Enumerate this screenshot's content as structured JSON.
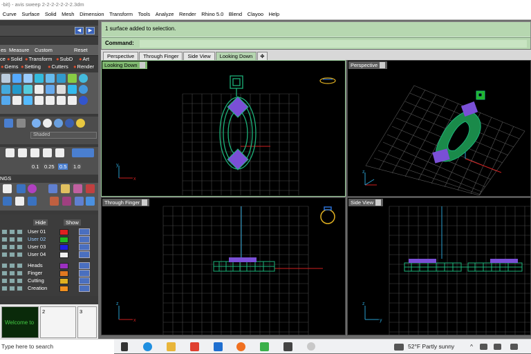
{
  "window": {
    "title": "-bit) - avis sweep 2-2-2-2-2-2-2.3dm"
  },
  "menu": {
    "items": [
      "Curve",
      "Surface",
      "Solid",
      "Mesh",
      "Dimension",
      "Transform",
      "Tools",
      "Analyze",
      "Render",
      "Rhino 5.0",
      "Blend",
      "Clayoo",
      "Help"
    ]
  },
  "command": {
    "history": "1 surface added to selection.",
    "prompt": "Command:"
  },
  "tabs": [
    "Perspective",
    "Through Finger",
    "Side View",
    "Looking Down"
  ],
  "tabs_active": "Looking Down",
  "viewports": {
    "looking_down": "Looking Down",
    "perspective": "Perspective",
    "through_finger": "Through Finger",
    "side_view": "Side View"
  },
  "left_panel": {
    "tabs": [
      "es",
      "Measure",
      "Custom"
    ],
    "reset": "Reset",
    "row1": [
      "ce",
      "Solid",
      "Transform",
      "SubD",
      "Art"
    ],
    "row2": [
      "Gems",
      "Setting",
      "Cutters",
      "Render"
    ],
    "display_mode": "Shaded",
    "values": [
      "0.1",
      "0.25",
      "0.5",
      "1.0"
    ],
    "ngs": "NGS",
    "hide": "Hide",
    "show": "Show",
    "layers": [
      {
        "name": "User 01",
        "color": "#e02020"
      },
      {
        "name": "User 02",
        "color": "#22b822"
      },
      {
        "name": "User 03",
        "color": "#2020e0"
      },
      {
        "name": "User 04",
        "color": "#f0f0f0"
      }
    ],
    "layers2": [
      {
        "name": "Heads",
        "color": "#9b30c0"
      },
      {
        "name": "Finger",
        "color": "#e07820"
      },
      {
        "name": "Cutting",
        "color": "#e0b020"
      },
      {
        "name": "Creation",
        "color": "#f09020"
      }
    ],
    "thumb_labels": [
      "2",
      "3"
    ],
    "welcome": "Welcome to"
  },
  "taskbar": {
    "search": "Type here to search",
    "weather": "52°F  Partly sunny"
  },
  "colors": {
    "accent_green": "#7fb870",
    "model_green": "#1db37a",
    "gem_purple": "#7a4fd6",
    "axis_red": "#d02020",
    "grid": "#4a4a4a"
  }
}
